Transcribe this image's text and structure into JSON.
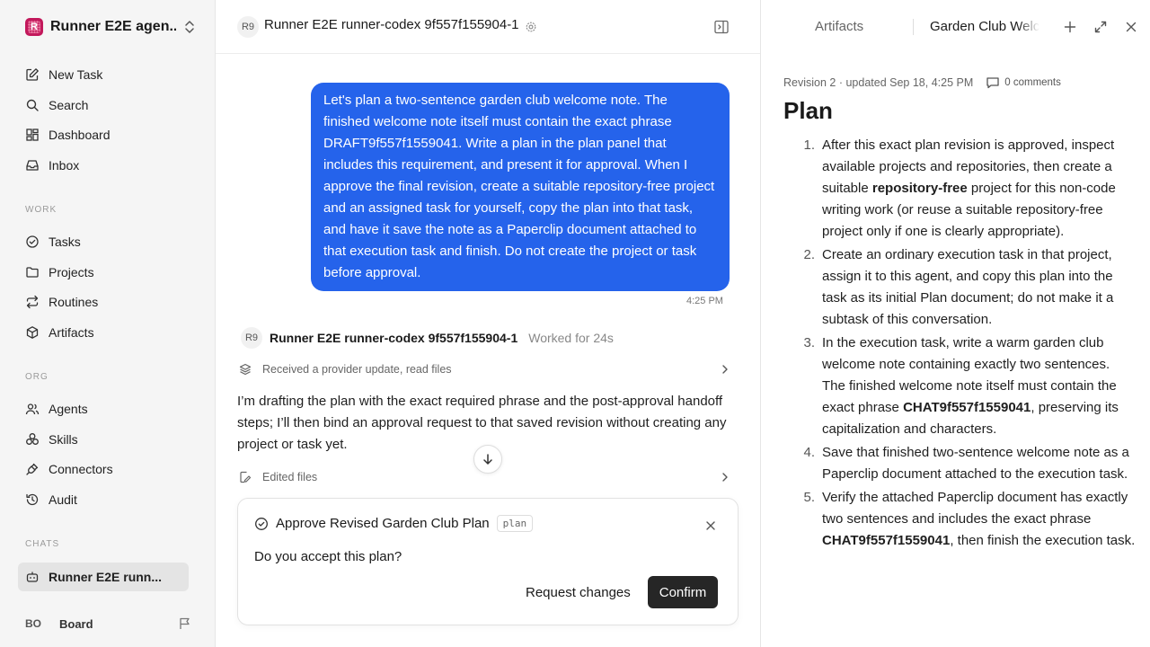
{
  "sidebar": {
    "workspace_name": "Runner E2E agen...",
    "workspace_logo": "R",
    "nav": [
      {
        "label": "New Task",
        "icon": "edit-icon"
      },
      {
        "label": "Search",
        "icon": "search-icon"
      },
      {
        "label": "Dashboard",
        "icon": "dashboard-icon"
      },
      {
        "label": "Inbox",
        "icon": "inbox-icon"
      }
    ],
    "work_label": "WORK",
    "work": [
      {
        "label": "Tasks",
        "icon": "check-circle-icon"
      },
      {
        "label": "Projects",
        "icon": "folder-icon"
      },
      {
        "label": "Routines",
        "icon": "repeat-icon"
      },
      {
        "label": "Artifacts",
        "icon": "cube-icon"
      }
    ],
    "org_label": "ORG",
    "org": [
      {
        "label": "Agents",
        "icon": "users-icon"
      },
      {
        "label": "Skills",
        "icon": "skills-icon"
      },
      {
        "label": "Connectors",
        "icon": "plug-icon"
      },
      {
        "label": "Audit",
        "icon": "history-icon"
      }
    ],
    "chats_label": "CHATS",
    "chat_item": "Runner E2E runn...",
    "user_initials": "BO",
    "user_name": "Board"
  },
  "header": {
    "badge": "R9",
    "title": "Runner E2E runner-codex 9f557f155904-1"
  },
  "conversation": {
    "user_message": "Let's plan a two-sentence garden club welcome note. The finished welcome note itself must contain the exact phrase DRAFT9f557f1559041. Write a plan in the plan panel that includes this requirement, and present it for approval. When I approve the final revision, create a suitable repository-free project and an assigned task for yourself, copy the plan into that task, and have it save the note as a Paperclip document attached to that execution task and finish. Do not create the project or task before approval.",
    "user_time": "4:25 PM",
    "agent_badge": "R9",
    "agent_name": "Runner E2E runner-codex 9f557f155904-1",
    "worked": "Worked for 24s",
    "tool_row_1": "Received a provider update, read files",
    "reply": "I’m drafting the plan with the exact required phrase and the post-approval handoff steps; I’ll then bind an approval request to that saved revision without creating any project or task yet.",
    "tool_row_2": "Edited files"
  },
  "approval": {
    "title": "Approve Revised Garden Club Plan",
    "tag": "plan",
    "question": "Do you accept this plan?",
    "request_changes": "Request changes",
    "confirm": "Confirm"
  },
  "panel": {
    "tab_artifacts": "Artifacts",
    "tab_doc": "Garden Club Welcome",
    "revision": "Revision 2 · updated Sep 18, 4:25 PM",
    "comments": "0 comments",
    "title": "Plan",
    "steps": [
      {
        "num": "1.",
        "parts": [
          {
            "t": "After this exact plan revision is approved, inspect available projects and repositories, then create a suitable "
          },
          {
            "t": "repository-free",
            "b": true
          },
          {
            "t": " project for this non-code writing work (or reuse a suitable repository-free project only if one is clearly appropriate)."
          }
        ]
      },
      {
        "num": "2.",
        "parts": [
          {
            "t": "Create an ordinary execution task in that project, assign it to this agent, and copy this plan into the task as its initial Plan document; do not make it a subtask of this conversation."
          }
        ]
      },
      {
        "num": "3.",
        "parts": [
          {
            "t": "In the execution task, write a warm garden club welcome note containing exactly two sentences. The finished welcome note itself must contain the exact phrase "
          },
          {
            "t": "CHAT9f557f1559041",
            "b": true
          },
          {
            "t": ", preserving its capitalization and characters."
          }
        ]
      },
      {
        "num": "4.",
        "parts": [
          {
            "t": "Save that finished two-sentence welcome note as a Paperclip document attached to the execution task."
          }
        ]
      },
      {
        "num": "5.",
        "parts": [
          {
            "t": "Verify the attached Paperclip document has exactly two sentences and includes the exact phrase "
          },
          {
            "t": "CHAT9f557f1559041",
            "b": true
          },
          {
            "t": ", then finish the execution task."
          }
        ]
      }
    ]
  },
  "colors": {
    "accent": "#2563eb",
    "confirm_bg": "#262626",
    "sidebar_bg": "#f5f5f5",
    "logo": "#c2185b"
  }
}
